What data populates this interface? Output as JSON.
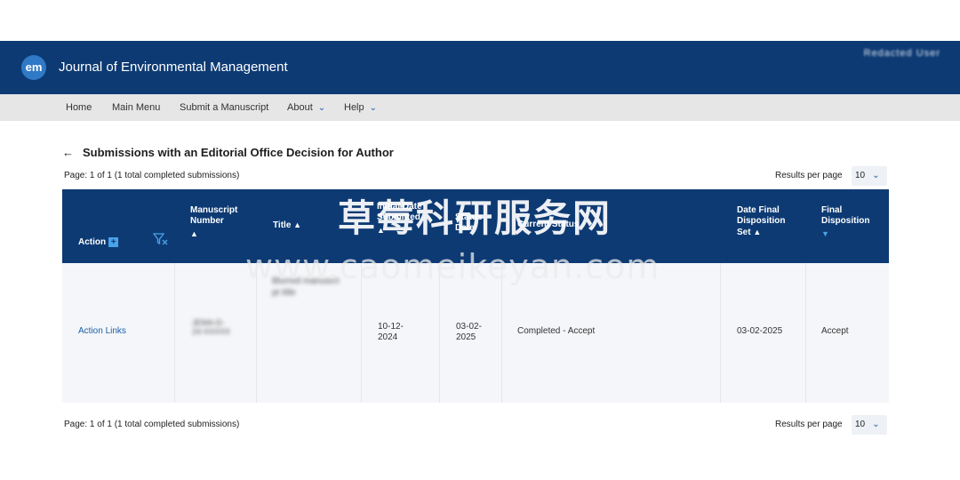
{
  "header": {
    "logo_text": "em",
    "journal_title": "Journal of Environmental Management",
    "username": "Redacted User"
  },
  "nav": {
    "items": [
      {
        "label": "Home",
        "has_dropdown": false
      },
      {
        "label": "Main Menu",
        "has_dropdown": false
      },
      {
        "label": "Submit a Manuscript",
        "has_dropdown": false
      },
      {
        "label": "About",
        "has_dropdown": true
      },
      {
        "label": "Help",
        "has_dropdown": true
      }
    ]
  },
  "page": {
    "back_icon": "arrow-left-icon",
    "heading": "Submissions with an Editorial Office Decision for Author",
    "pagination_text": "Page: 1 of 1 (1 total completed submissions)",
    "results_per_page_label": "Results per page",
    "results_per_page_value": "10"
  },
  "table": {
    "headers": {
      "action": "Action",
      "manuscript_number": "Manuscript Number",
      "title": "Title",
      "initial_date_submitted": "Initial Date Submitted",
      "status_date": "Status Date",
      "current_status": "Current Status",
      "date_final_disposition": "Date Final Disposition Set",
      "final_disposition": "Final Disposition"
    },
    "rows": [
      {
        "action": "Action Links",
        "manuscript_number": "JEMA-D-24-XXXXX",
        "title": "Blurred manuscript title",
        "initial_date_submitted": "10-12-2024",
        "status_date": "03-02-2025",
        "current_status": "Completed - Accept",
        "date_final_disposition": "03-02-2025",
        "final_disposition": "Accept"
      }
    ]
  },
  "footer": {
    "pagination_text": "Page: 1 of 1 (1 total completed submissions)",
    "results_per_page_label": "Results per page",
    "results_per_page_value": "10"
  },
  "watermark": {
    "cn": "草莓科研服务网",
    "en": "www.caomeikeyan.com"
  },
  "colors": {
    "header_bg": "#0d3a73",
    "accent": "#1c5ea8",
    "sort_active": "#4aa3e8"
  }
}
